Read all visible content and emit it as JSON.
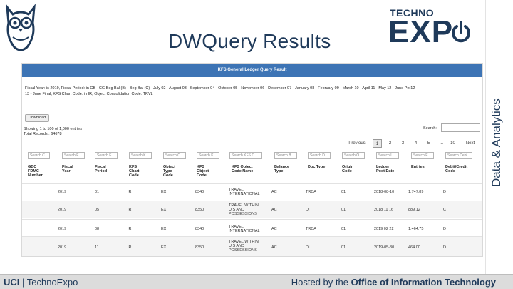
{
  "slide": {
    "title": "DWQuery Results",
    "side_label": "Data & Analytics",
    "logo_top": "TECHNO",
    "logo_main": "EXP",
    "footer_left_org": "UCI",
    "footer_left_sep": " | ",
    "footer_left_event": "TechnoExpo",
    "footer_right_prefix": "Hosted by the ",
    "footer_right_org": "Office of Information Technology",
    "colors": {
      "navy": "#1f3a5a",
      "header_blue": "#3d74b5",
      "footer_gray": "#dcdcdc"
    }
  },
  "shot": {
    "header": "KFS General Ledger Query Result",
    "params_line1": "Fiscal Year: is 2019, Fiscal Period: in CB - CG Beg Bal (B) - Beg Bal (C) - July 02 - August 03 - September 04 - October 05 - November 06 - December 07 - January 08 - February 09 - March 10 - April 11 - May 12 - June Per12",
    "params_line2": "13 - June Final, KFS Chart Code: in IR, Object Consolidation Code: TRVL",
    "download": "Download",
    "entries_line1": "Showing 1 to 100 of 1,000 entries",
    "entries_line2": "Total Records : 64678",
    "search_label": "Search:",
    "pager": {
      "prev": "Previous",
      "p1": "1",
      "p2": "2",
      "p3": "3",
      "p4": "4",
      "p5": "5",
      "ellipsis": "...",
      "p10": "10",
      "next": "Next"
    },
    "filters": [
      "Search C",
      "Search F",
      "Search F",
      "Search K",
      "Search O",
      "Search K",
      "Search KFS C",
      "Search B",
      "Search D",
      "Search O",
      "Search L",
      "Search E",
      "Search Debi"
    ],
    "columns": [
      "GBC\nFDMC\nNumber",
      "Fiscal\nYear",
      "Fiscal\nPeriod",
      "KFS\nChart\nCode",
      "Object\nType\nCode",
      "KFS\nObject\nCode",
      "KFS Object\nCode Name",
      "Balance\nType",
      "Doc Type",
      "Origin\nCode",
      "Ledger\nPost Date",
      "Entries",
      "Debit/Credit\nCode"
    ],
    "rows": [
      {
        "fdmc": "",
        "year": "2019",
        "period": "01",
        "chart": "IR",
        "objtype": "EX",
        "objcode": "8340",
        "objname": "TRAVEL\nINTERNATIONAL",
        "baltype": "AC",
        "doctype": "TRCA",
        "origin": "01",
        "postdate": "2018-08-10",
        "entries": "1,747.89",
        "dc": "D"
      },
      {
        "fdmc": "",
        "year": "2019",
        "period": "05",
        "chart": "IR",
        "objtype": "EX",
        "objcode": "8350",
        "objname": "TRAVEL WITHIN\nU S AND\nPOSSESSIONS",
        "baltype": "AC",
        "doctype": "DI",
        "origin": "01",
        "postdate": "2018 11 16",
        "entries": "889.12",
        "dc": "C"
      },
      {
        "fdmc": "",
        "year": "2019",
        "period": "08",
        "chart": "IR",
        "objtype": "EX",
        "objcode": "8340",
        "objname": "TRAVEL\nINTERNATIONAL",
        "baltype": "AC",
        "doctype": "TRCA",
        "origin": "01",
        "postdate": "2019 02 22",
        "entries": "1,464.75",
        "dc": "D"
      },
      {
        "fdmc": "",
        "year": "2019",
        "period": "11",
        "chart": "IR",
        "objtype": "EX",
        "objcode": "8350",
        "objname": "TRAVEL WITHIN\nU S AND\nPOSSESSIONS",
        "baltype": "AC",
        "doctype": "DI",
        "origin": "01",
        "postdate": "2019-05-30",
        "entries": "464.00",
        "dc": "D"
      }
    ]
  }
}
